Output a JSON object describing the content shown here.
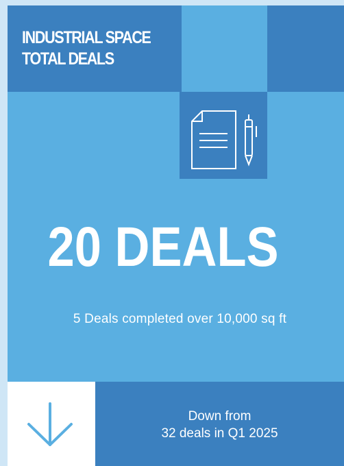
{
  "header": {
    "title_line1": "INDUSTRIAL SPACE",
    "title_line2": "TOTAL DEALS"
  },
  "stat": {
    "value": "20 DEALS",
    "detail": "5 Deals completed over 10,000 sq ft"
  },
  "comparison": {
    "line1": "Down from",
    "line2": "32 deals in Q1 2025",
    "trend_icon": "arrow-down-icon"
  },
  "icons": {
    "document": "document-pen-icon"
  },
  "colors": {
    "light_blue": "#5aafe1",
    "dark_blue": "#3b80bf",
    "arrow": "#5aafe1",
    "page_bg": "#cfe6f6"
  }
}
